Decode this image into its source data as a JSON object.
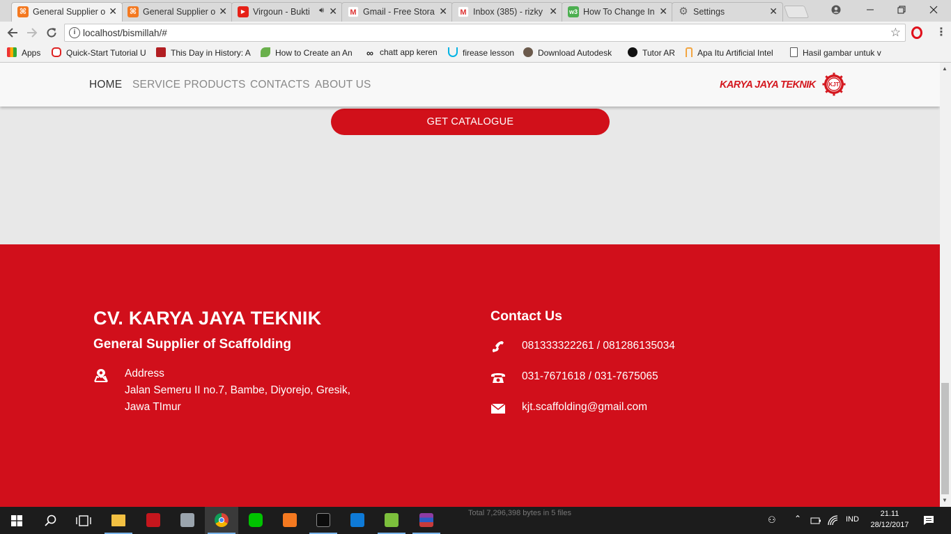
{
  "browser": {
    "tabs": [
      {
        "title": "General Supplier o",
        "favicon": "xampp-icon",
        "active": true
      },
      {
        "title": "General Supplier o",
        "favicon": "xampp-icon",
        "active": false
      },
      {
        "title": "Virgoun - Bukti",
        "favicon": "youtube-icon",
        "active": false
      },
      {
        "title": "Gmail - Free Stora",
        "favicon": "gmail-icon",
        "active": false
      },
      {
        "title": "Inbox (385) - rizky",
        "favicon": "gmail-icon",
        "active": false
      },
      {
        "title": "How To Change In",
        "favicon": "w3schools-icon",
        "active": false
      },
      {
        "title": "Settings",
        "favicon": "gear-icon",
        "active": false
      }
    ],
    "close_glyph": "✕",
    "url": "localhost/bismillah/#",
    "bookmarks": [
      {
        "label": "Apps",
        "icon": "apps-grid-icon"
      },
      {
        "label": "Quick-Start Tutorial U",
        "icon": "oracle-icon"
      },
      {
        "label": "This Day in History: A",
        "icon": "history-icon"
      },
      {
        "label": "How to Create an An",
        "icon": "android-leaf-icon"
      },
      {
        "label": "chatt app keren",
        "icon": "infinity-icon"
      },
      {
        "label": "firease lesson",
        "icon": "udacity-icon"
      },
      {
        "label": "Download Autodesk",
        "icon": "autodesk-icon"
      },
      {
        "label": "Tutor AR",
        "icon": "unity-icon"
      },
      {
        "label": "Apa Itu Artificial Intel",
        "icon": "bookmark-icon"
      },
      {
        "label": "Hasil gambar untuk v",
        "icon": "page-icon"
      }
    ]
  },
  "site": {
    "nav": {
      "items": [
        "HOME",
        "SERVICE",
        "PRODUCTS",
        "CONTACTS",
        "ABOUT US"
      ],
      "active": "HOME",
      "brand_text": "KARYA JAYA TEKNIK",
      "brand_emblem": "KJT"
    },
    "catalogue_button": "GET CATALOGUE",
    "footer": {
      "company_name": "CV. KARYA JAYA TEKNIK",
      "tagline": "General Supplier of Scaffolding",
      "address_label": "Address",
      "address_line1": "Jalan Semeru II no.7, Bambe, Diyorejo, Gresik,",
      "address_line2": "Jawa TImur",
      "contact_title": "Contact Us",
      "mobile": "081333322261 / 081286135034",
      "phone": "031-7671618 / 031-7675065",
      "email": "kjt.scaffolding@gmail.com"
    }
  },
  "taskbar": {
    "status_text": "Total 7,296,398 bytes in 5 files",
    "language": "IND",
    "time": "21.11",
    "date": "28/12/2017"
  },
  "colors": {
    "brand_red": "#d10f1b",
    "page_gray": "#e8e8e8",
    "nav_bg": "#f8f8f8"
  }
}
